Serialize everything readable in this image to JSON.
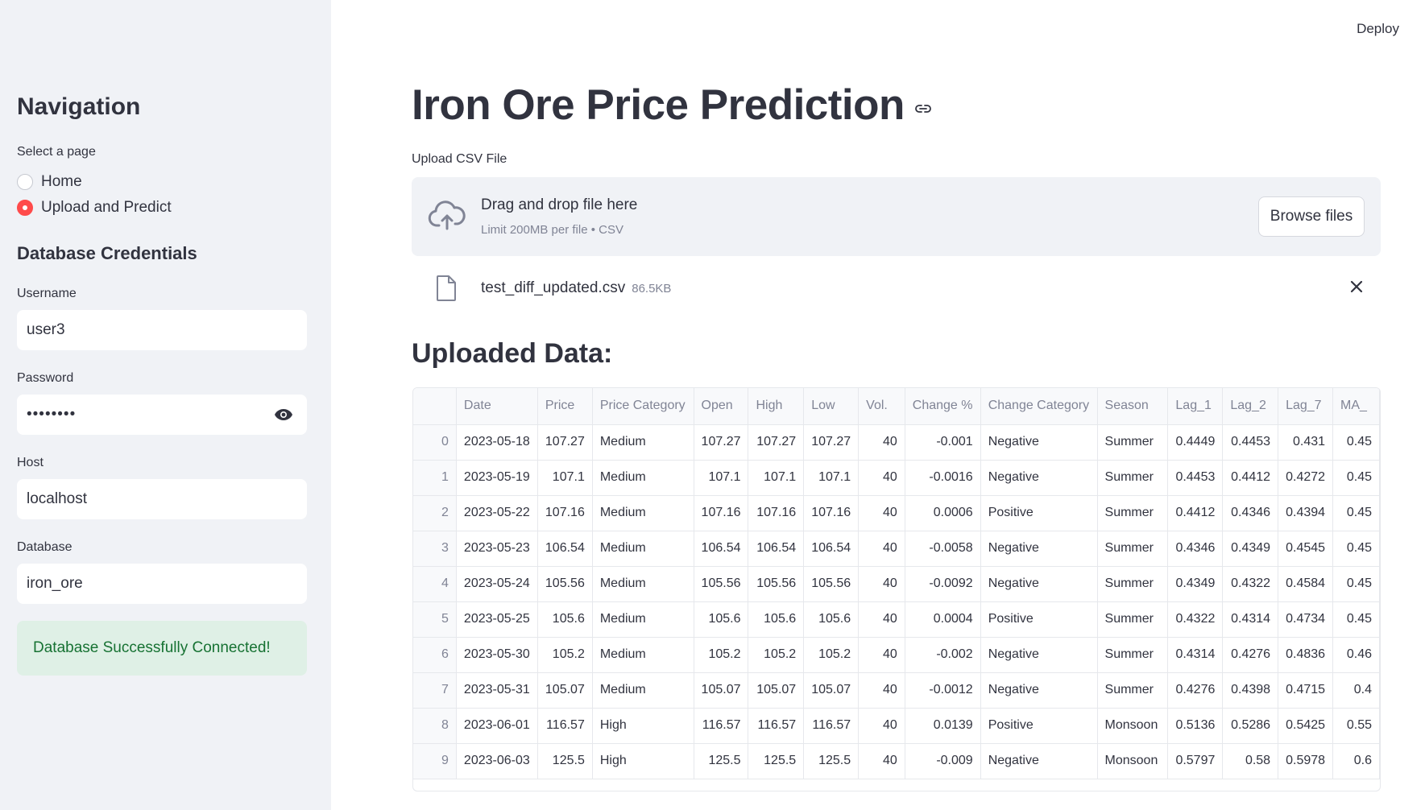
{
  "sidebar": {
    "nav_title": "Navigation",
    "select_label": "Select a page",
    "pages": [
      "Home",
      "Upload and Predict"
    ],
    "selected_page": "Upload and Predict",
    "credentials_title": "Database Credentials",
    "username_label": "Username",
    "username_value": "user3",
    "password_label": "Password",
    "password_value": "••••••••",
    "host_label": "Host",
    "host_value": "localhost",
    "database_label": "Database",
    "database_value": "iron_ore",
    "status_message": "Database Successfully Connected!"
  },
  "header": {
    "deploy_label": "Deploy"
  },
  "main": {
    "title": "Iron Ore Price Prediction",
    "upload_label": "Upload CSV File",
    "dropzone_title": "Drag and drop file here",
    "dropzone_limit": "Limit 200MB per file • CSV",
    "browse_label": "Browse files",
    "file_name": "test_diff_updated.csv",
    "file_size": "86.5KB",
    "data_heading": "Uploaded Data:"
  },
  "table": {
    "columns": [
      "",
      "Date",
      "Price",
      "Price Category",
      "Open",
      "High",
      "Low",
      "Vol.",
      "Change %",
      "Change Category",
      "Season",
      "Lag_1",
      "Lag_2",
      "Lag_7",
      "MA_"
    ],
    "rows": [
      [
        "0",
        "2023-05-18",
        "107.27",
        "Medium",
        "107.27",
        "107.27",
        "107.27",
        "40",
        "-0.001",
        "Negative",
        "Summer",
        "0.4449",
        "0.4453",
        "0.431",
        "0.45"
      ],
      [
        "1",
        "2023-05-19",
        "107.1",
        "Medium",
        "107.1",
        "107.1",
        "107.1",
        "40",
        "-0.0016",
        "Negative",
        "Summer",
        "0.4453",
        "0.4412",
        "0.4272",
        "0.45"
      ],
      [
        "2",
        "2023-05-22",
        "107.16",
        "Medium",
        "107.16",
        "107.16",
        "107.16",
        "40",
        "0.0006",
        "Positive",
        "Summer",
        "0.4412",
        "0.4346",
        "0.4394",
        "0.45"
      ],
      [
        "3",
        "2023-05-23",
        "106.54",
        "Medium",
        "106.54",
        "106.54",
        "106.54",
        "40",
        "-0.0058",
        "Negative",
        "Summer",
        "0.4346",
        "0.4349",
        "0.4545",
        "0.45"
      ],
      [
        "4",
        "2023-05-24",
        "105.56",
        "Medium",
        "105.56",
        "105.56",
        "105.56",
        "40",
        "-0.0092",
        "Negative",
        "Summer",
        "0.4349",
        "0.4322",
        "0.4584",
        "0.45"
      ],
      [
        "5",
        "2023-05-25",
        "105.6",
        "Medium",
        "105.6",
        "105.6",
        "105.6",
        "40",
        "0.0004",
        "Positive",
        "Summer",
        "0.4322",
        "0.4314",
        "0.4734",
        "0.45"
      ],
      [
        "6",
        "2023-05-30",
        "105.2",
        "Medium",
        "105.2",
        "105.2",
        "105.2",
        "40",
        "-0.002",
        "Negative",
        "Summer",
        "0.4314",
        "0.4276",
        "0.4836",
        "0.46"
      ],
      [
        "7",
        "2023-05-31",
        "105.07",
        "Medium",
        "105.07",
        "105.07",
        "105.07",
        "40",
        "-0.0012",
        "Negative",
        "Summer",
        "0.4276",
        "0.4398",
        "0.4715",
        "0.4"
      ],
      [
        "8",
        "2023-06-01",
        "116.57",
        "High",
        "116.57",
        "116.57",
        "116.57",
        "40",
        "0.0139",
        "Positive",
        "Monsoon",
        "0.5136",
        "0.5286",
        "0.5425",
        "0.55"
      ],
      [
        "9",
        "2023-06-03",
        "125.5",
        "High",
        "125.5",
        "125.5",
        "125.5",
        "40",
        "-0.009",
        "Negative",
        "Monsoon",
        "0.5797",
        "0.58",
        "0.5978",
        "0.6"
      ]
    ]
  },
  "colors": {
    "accent": "#ff4b4b",
    "success_bg": "#dff0e6",
    "success_text": "#177233",
    "sidebar_bg": "#f0f2f6"
  }
}
